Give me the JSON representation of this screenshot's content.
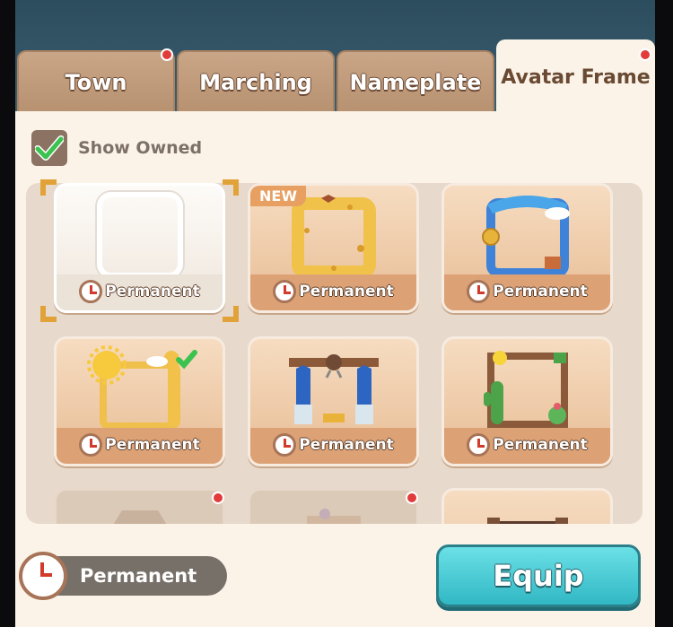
{
  "tabs": [
    {
      "label": "Town",
      "has_alert": true
    },
    {
      "label": "Marching",
      "has_alert": false
    },
    {
      "label": "Nameplate",
      "has_alert": false
    },
    {
      "label": "Avatar Frame",
      "has_alert": true,
      "active": true
    }
  ],
  "filter": {
    "show_owned_label": "Show Owned",
    "checked": true
  },
  "frames": [
    {
      "label": "Permanent",
      "selected": true,
      "theme": "blank"
    },
    {
      "label": "Permanent",
      "badge": "NEW",
      "theme": "cheese"
    },
    {
      "label": "Permanent",
      "theme": "blue-ribbon"
    },
    {
      "label": "Permanent",
      "theme": "sun-giraffe",
      "owned_check": true
    },
    {
      "label": "Permanent",
      "theme": "claw-machine"
    },
    {
      "label": "Permanent",
      "theme": "cactus-wood"
    }
  ],
  "partial_row": [
    {
      "has_alert": true
    },
    {
      "has_alert": true
    },
    {
      "has_alert": false
    }
  ],
  "bottom": {
    "duration_label": "Permanent",
    "equip_label": "Equip"
  },
  "colors": {
    "accent": "#31b8c4",
    "tab": "#c9a687",
    "panel": "#fbf3e8",
    "alert": "#e23b3b"
  }
}
